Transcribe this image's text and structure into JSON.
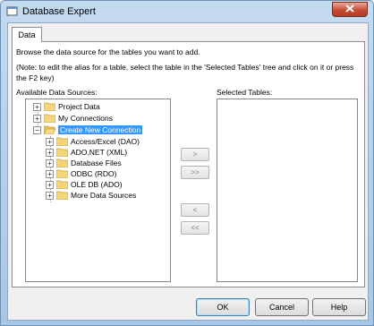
{
  "window": {
    "title": "Database Expert",
    "close_icon": "close-icon"
  },
  "tab": {
    "label": "Data"
  },
  "instructions": {
    "line1": "Browse the data source for the tables you want to add.",
    "note": "(Note: to edit the alias for a table, select the table in the 'Selected Tables' tree and click on it or press the F2 key)"
  },
  "available": {
    "label": "Available Data Sources:",
    "items": [
      {
        "label": "Project Data",
        "expander": "+"
      },
      {
        "label": "My Connections",
        "expander": "+"
      },
      {
        "label": "Create New Connection",
        "expander": "−",
        "selected": true
      },
      {
        "label": "Access/Excel (DAO)",
        "expander": "+"
      },
      {
        "label": "ADO.NET (XML)",
        "expander": "+"
      },
      {
        "label": "Database Files",
        "expander": "+"
      },
      {
        "label": "ODBC (RDO)",
        "expander": "+"
      },
      {
        "label": "OLE DB (ADO)",
        "expander": "+"
      },
      {
        "label": "More Data Sources",
        "expander": "+"
      }
    ]
  },
  "selected": {
    "label": "Selected Tables:"
  },
  "move_buttons": {
    "add": ">",
    "add_all": ">>",
    "remove": "<",
    "remove_all": "<<"
  },
  "buttons": {
    "ok": "OK",
    "cancel": "Cancel",
    "help": "Help"
  },
  "colors": {
    "selection": "#3399ff",
    "title_bar": "#c3daf0",
    "close_button": "#c74c35"
  }
}
